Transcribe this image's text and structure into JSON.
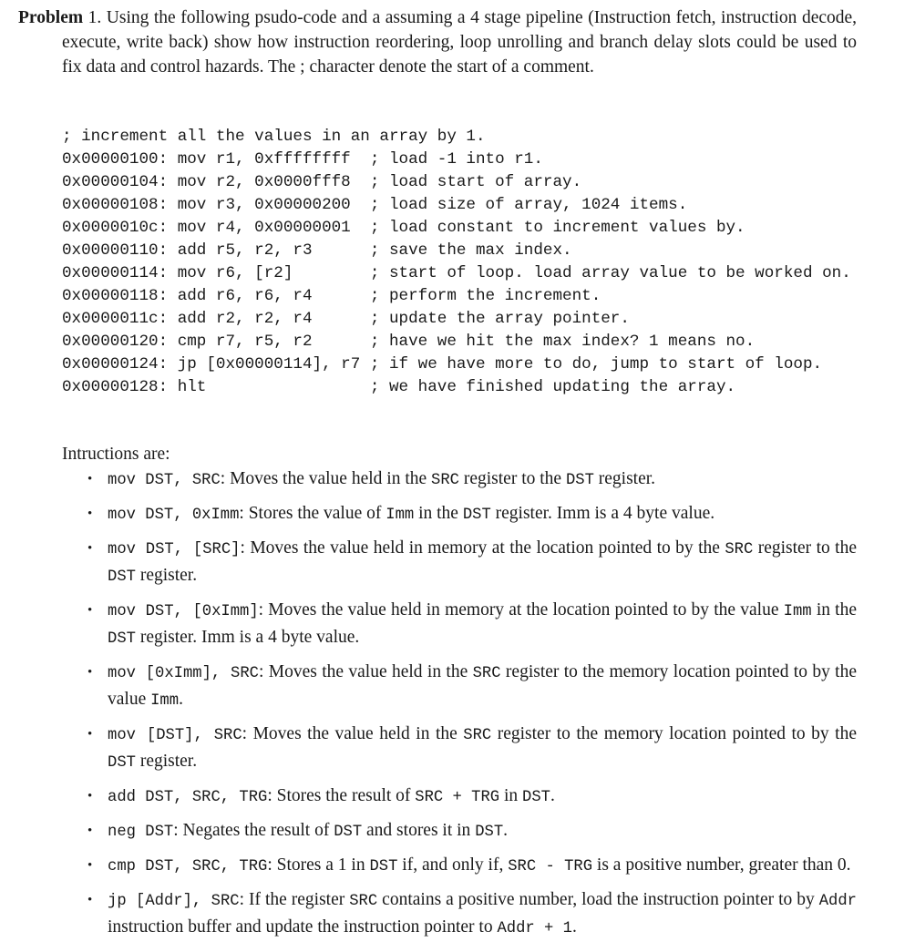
{
  "document": {
    "problem": {
      "label": "Problem",
      "number": "1.",
      "text": "Using the following psudo-code and a assuming a 4 stage pipeline (Instruction fetch, instruction decode, execute, write back) show how instruction reordering, loop unrolling and branch delay slots could be used to fix data and control hazards. The ; character denote the start of a comment."
    },
    "code_listing": [
      "; increment all the values in an array by 1.",
      "0x00000100: mov r1, 0xffffffff  ; load -1 into r1.",
      "0x00000104: mov r2, 0x0000fff8  ; load start of array.",
      "0x00000108: mov r3, 0x00000200  ; load size of array, 1024 items.",
      "0x0000010c: mov r4, 0x00000001  ; load constant to increment values by.",
      "0x00000110: add r5, r2, r3      ; save the max index.",
      "0x00000114: mov r6, [r2]        ; start of loop. load array value to be worked on.",
      "0x00000118: add r6, r6, r4      ; perform the increment.",
      "0x0000011c: add r2, r2, r4      ; update the array pointer.",
      "0x00000120: cmp r7, r5, r2      ; have we hit the max index? 1 means no.",
      "0x00000124: jp [0x00000114], r7 ; if we have more to do, jump to start of loop.",
      "0x00000128: hlt                 ; we have finished updating the array."
    ],
    "instructions_heading": "Intructions are:",
    "bullet_glyph": "•",
    "instructions": [
      {
        "signature": "mov DST, SRC",
        "parts": [
          {
            "style": "mono",
            "text": "mov DST, SRC"
          },
          {
            "style": "serif",
            "text": ": Moves the value held in the "
          },
          {
            "style": "mono",
            "text": "SRC"
          },
          {
            "style": "serif",
            "text": " register to the "
          },
          {
            "style": "mono",
            "text": "DST"
          },
          {
            "style": "serif",
            "text": " register."
          }
        ]
      },
      {
        "signature": "mov DST, 0xImm",
        "parts": [
          {
            "style": "mono",
            "text": "mov DST, 0xImm"
          },
          {
            "style": "serif",
            "text": ": Stores the value of "
          },
          {
            "style": "mono",
            "text": "Imm"
          },
          {
            "style": "serif",
            "text": " in the "
          },
          {
            "style": "mono",
            "text": "DST"
          },
          {
            "style": "serif",
            "text": " register. Imm is a 4 byte value."
          }
        ]
      },
      {
        "signature": "mov DST, [SRC]",
        "parts": [
          {
            "style": "mono",
            "text": "mov DST, [SRC]"
          },
          {
            "style": "serif",
            "text": ": Moves the value held in memory at the location pointed to by the "
          },
          {
            "style": "mono",
            "text": "SRC"
          },
          {
            "style": "serif",
            "text": " register to the "
          },
          {
            "style": "mono",
            "text": "DST"
          },
          {
            "style": "serif",
            "text": " register."
          }
        ]
      },
      {
        "signature": "mov DST, [0xImm]",
        "parts": [
          {
            "style": "mono",
            "text": "mov DST, [0xImm]"
          },
          {
            "style": "serif",
            "text": ": Moves the value held in memory at the location pointed to by the value "
          },
          {
            "style": "mono",
            "text": "Imm"
          },
          {
            "style": "serif",
            "text": " in the "
          },
          {
            "style": "mono",
            "text": "DST"
          },
          {
            "style": "serif",
            "text": " register. Imm is a 4 byte value."
          }
        ]
      },
      {
        "signature": "mov [0xImm], SRC",
        "parts": [
          {
            "style": "mono",
            "text": "mov [0xImm], SRC"
          },
          {
            "style": "serif",
            "text": ": Moves the value held in the "
          },
          {
            "style": "mono",
            "text": "SRC"
          },
          {
            "style": "serif",
            "text": " register to the memory location pointed to by the value "
          },
          {
            "style": "mono",
            "text": "Imm"
          },
          {
            "style": "serif",
            "text": "."
          }
        ]
      },
      {
        "signature": "mov [DST], SRC",
        "parts": [
          {
            "style": "mono",
            "text": "mov [DST], SRC"
          },
          {
            "style": "serif",
            "text": ": Moves the value held in the "
          },
          {
            "style": "mono",
            "text": "SRC"
          },
          {
            "style": "serif",
            "text": " register to the memory location pointed to by the "
          },
          {
            "style": "mono",
            "text": "DST"
          },
          {
            "style": "serif",
            "text": " register."
          }
        ]
      },
      {
        "signature": "add DST, SRC, TRG",
        "parts": [
          {
            "style": "mono",
            "text": "add DST, SRC, TRG"
          },
          {
            "style": "serif",
            "text": ": Stores the result of "
          },
          {
            "style": "mono",
            "text": "SRC + TRG"
          },
          {
            "style": "serif",
            "text": " in "
          },
          {
            "style": "mono",
            "text": "DST"
          },
          {
            "style": "serif",
            "text": "."
          }
        ]
      },
      {
        "signature": "neg DST",
        "parts": [
          {
            "style": "mono",
            "text": "neg DST"
          },
          {
            "style": "serif",
            "text": ": Negates the result of "
          },
          {
            "style": "mono",
            "text": "DST"
          },
          {
            "style": "serif",
            "text": " and stores it in "
          },
          {
            "style": "mono",
            "text": "DST"
          },
          {
            "style": "serif",
            "text": "."
          }
        ]
      },
      {
        "signature": "cmp DST, SRC, TRG",
        "parts": [
          {
            "style": "mono",
            "text": "cmp DST, SRC, TRG"
          },
          {
            "style": "serif",
            "text": ": Stores a 1 in "
          },
          {
            "style": "mono",
            "text": "DST"
          },
          {
            "style": "serif",
            "text": " if, and only if, "
          },
          {
            "style": "mono",
            "text": "SRC - TRG"
          },
          {
            "style": "serif",
            "text": " is a positive number, greater than 0."
          }
        ]
      },
      {
        "signature": "jp [Addr], SRC",
        "parts": [
          {
            "style": "mono",
            "text": "jp [Addr], SRC"
          },
          {
            "style": "serif",
            "text": ": If the register "
          },
          {
            "style": "mono",
            "text": "SRC"
          },
          {
            "style": "serif",
            "text": " contains a positive number, load the instruction pointer to by "
          },
          {
            "style": "mono",
            "text": "Addr"
          },
          {
            "style": "serif",
            "text": " instruction buffer and update the instruction pointer to "
          },
          {
            "style": "mono",
            "text": "Addr + 1"
          },
          {
            "style": "serif",
            "text": "."
          }
        ]
      }
    ]
  }
}
